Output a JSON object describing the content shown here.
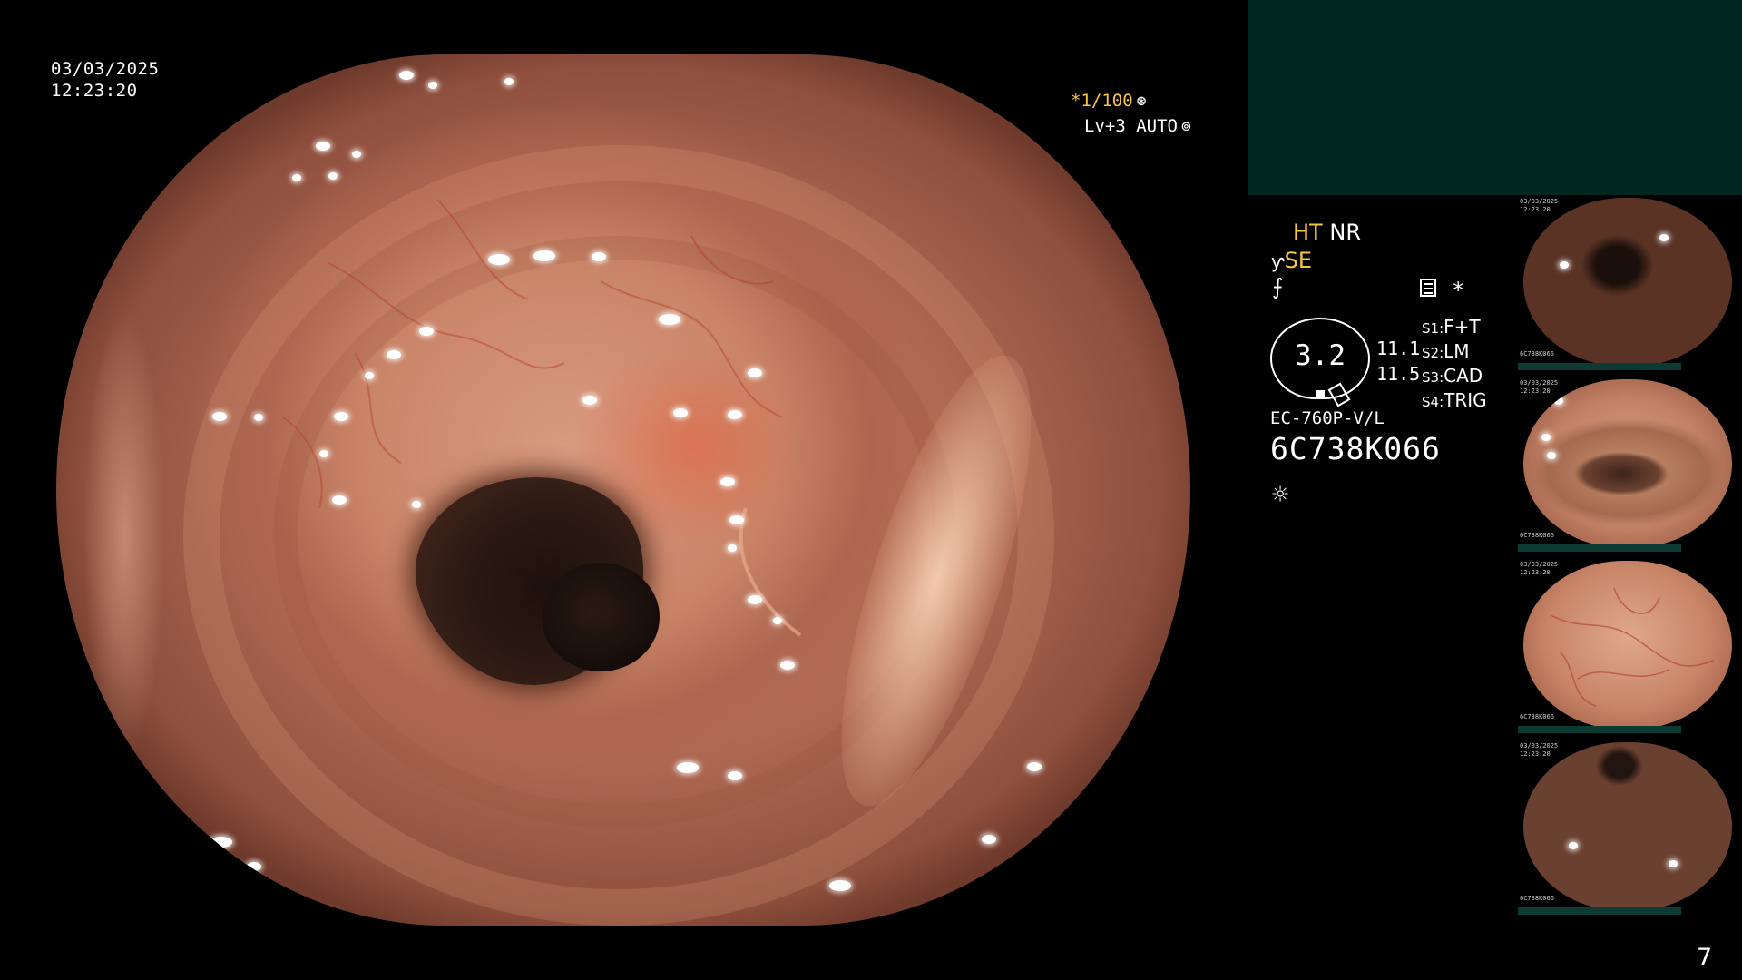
{
  "overlay": {
    "date": "03/03/2025",
    "time": "12:23:20",
    "shutter": "*1/100",
    "level": "Lv+3",
    "iris_mode": "AUTO",
    "shutter_icon": "aperture-icon",
    "iris_icon": "iris-icon"
  },
  "status_panel": {
    "ht_label": "HT",
    "nr_label": "NR",
    "se_label": "SE",
    "mode_color": "#f5c542",
    "zoom_value": "3.2",
    "value_1": "11.1",
    "value_2": "11.5",
    "settings": [
      {
        "key": "S1:",
        "value": "F+T"
      },
      {
        "key": "S2:",
        "value": "LM"
      },
      {
        "key": "S3:",
        "value": "CAD"
      },
      {
        "key": "S4:",
        "value": "TRIG"
      }
    ],
    "scope_model": "EC-760P-V/L",
    "serial_number": "6C738K066",
    "icons": [
      "structure-enhancement-icon",
      "freeze-icon",
      "report-icon",
      "asterisk-icon",
      "light-icon"
    ]
  },
  "thumbnails": [
    {
      "date": "03/03/2025",
      "time": "12:23:20",
      "serial": "6C738K066"
    },
    {
      "date": "03/03/2025",
      "time": "12:23:20",
      "serial": "6C738K066"
    },
    {
      "date": "03/03/2025",
      "time": "12:23:20",
      "serial": "6C738K066"
    },
    {
      "date": "03/03/2025",
      "time": "12:23:20",
      "serial": "6C738K066"
    }
  ],
  "page_number": "7",
  "colors": {
    "top_right_panel": "#002620",
    "mucosa": "#c98467",
    "lumen": "#1d110d"
  }
}
